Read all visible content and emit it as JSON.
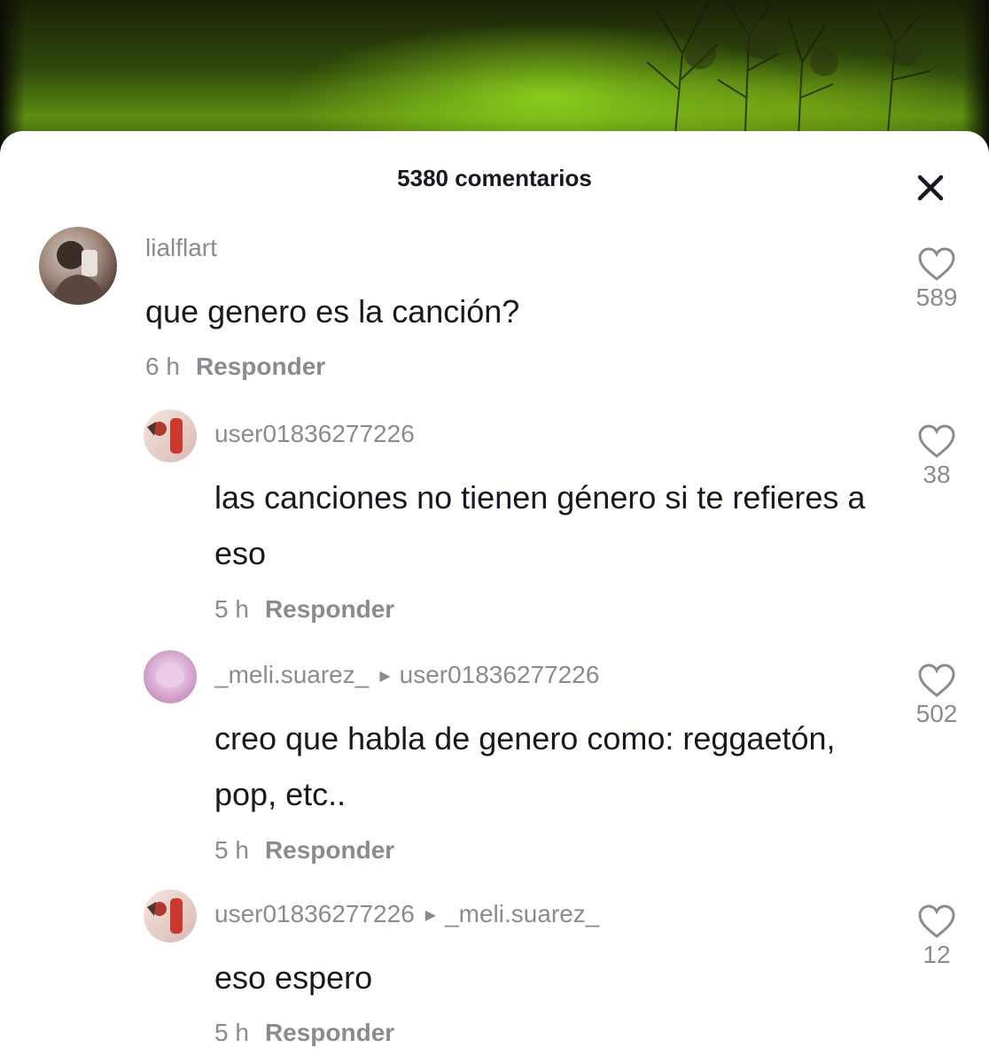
{
  "sheet": {
    "title": "5380 comentarios"
  },
  "icons": {
    "close": "close-icon",
    "heart": "heart-outline-icon",
    "reply_arrow": "triangle-right-icon"
  },
  "colors": {
    "text_primary": "#161823",
    "text_secondary": "#8a8b91",
    "background": "#ffffff"
  },
  "comments": [
    {
      "user": "lialflart",
      "reply_to": "",
      "text": "que genero es la canción?",
      "time": "6 h",
      "reply_label": "Responder",
      "likes": "589"
    },
    {
      "user": "user01836277226",
      "reply_to": "",
      "text": "las canciones no tienen género si te refieres a eso",
      "time": "5 h",
      "reply_label": "Responder",
      "likes": "38"
    },
    {
      "user": "_meli.suarez_",
      "reply_to": "user01836277226",
      "text": "creo que habla de genero como: reggaetón, pop, etc..",
      "time": "5 h",
      "reply_label": "Responder",
      "likes": "502"
    },
    {
      "user": "user01836277226",
      "reply_to": "_meli.suarez_",
      "text": "eso espero",
      "time": "5 h",
      "reply_label": "Responder",
      "likes": "12"
    }
  ]
}
